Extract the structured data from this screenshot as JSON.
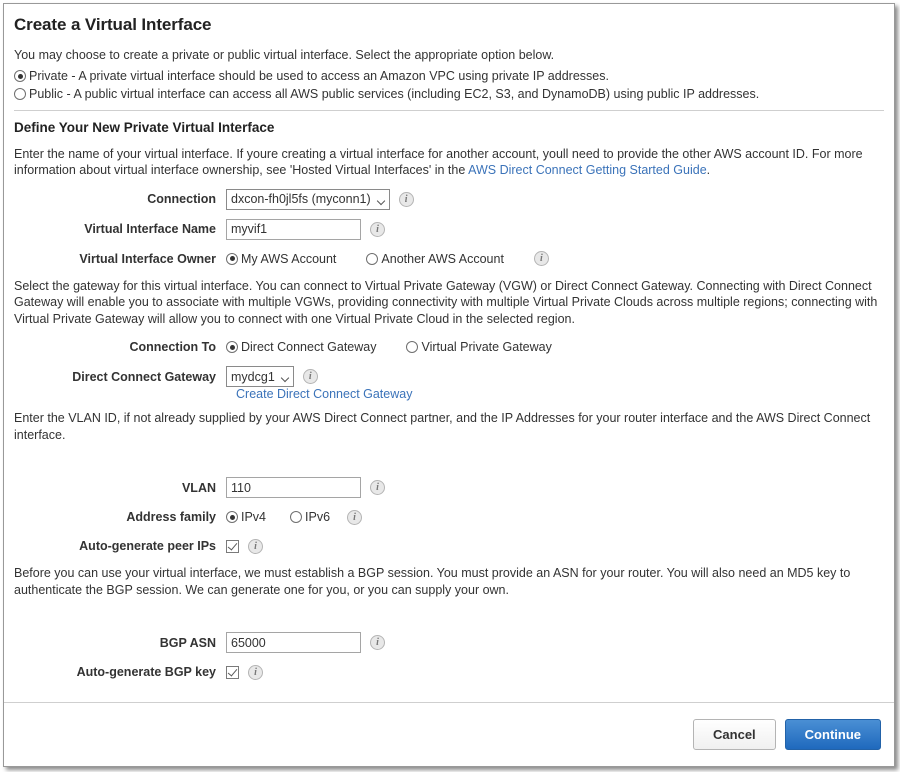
{
  "page": {
    "title": "Create a Virtual Interface",
    "intro": "You may choose to create a private or public virtual interface. Select the appropriate option below."
  },
  "interface_type": {
    "options": [
      {
        "label": "Private - A private virtual interface should be used to access an Amazon VPC using private IP addresses.",
        "selected": true
      },
      {
        "label": "Public - A public virtual interface can access all AWS public services (including EC2, S3, and DynamoDB) using public IP addresses.",
        "selected": false
      }
    ]
  },
  "define_section": {
    "heading": "Define Your New Private Virtual Interface",
    "description_part1": "Enter the name of your virtual interface. If youre creating a virtual interface for another account, youll need to provide the other AWS account ID. For more information about virtual interface ownership, see 'Hosted Virtual Interfaces' in the ",
    "link_text": "AWS Direct Connect Getting Started Guide",
    "description_part2": "."
  },
  "fields": {
    "connection": {
      "label": "Connection",
      "value": "dxcon-fh0jl5fs (myconn1)",
      "info": "i"
    },
    "virtual_interface_name": {
      "label": "Virtual Interface Name",
      "value": "myvif1",
      "placeholder": "",
      "info": "i"
    },
    "virtual_interface_owner": {
      "label": "Virtual Interface Owner",
      "options": [
        {
          "label": "My AWS Account",
          "selected": true
        },
        {
          "label": "Another AWS Account",
          "selected": false
        }
      ],
      "info": "i"
    },
    "connection_to": {
      "label": "Connection To",
      "options": [
        {
          "label": "Direct Connect Gateway",
          "selected": true
        },
        {
          "label": "Virtual Private Gateway",
          "selected": false
        }
      ]
    },
    "direct_connect_gateway": {
      "label": "Direct Connect Gateway",
      "value": "mydcg1",
      "info": "i",
      "create_link": "Create Direct Connect Gateway"
    },
    "vlan": {
      "label": "VLAN",
      "value": "110",
      "placeholder": "",
      "info": "i"
    },
    "address_family": {
      "label": "Address family",
      "options": [
        {
          "label": "IPv4",
          "selected": true
        },
        {
          "label": "IPv6",
          "selected": false
        }
      ],
      "info": "i"
    },
    "auto_generate_peer_ips": {
      "label": "Auto-generate peer IPs",
      "checked": true,
      "info": "i"
    },
    "bgp_asn": {
      "label": "BGP ASN",
      "value": "65000",
      "placeholder": "",
      "info": "i"
    },
    "auto_generate_bgp_key": {
      "label": "Auto-generate BGP key",
      "checked": true,
      "info": "i"
    }
  },
  "gateway_paragraph": "Select the gateway for this virtual interface. You can connect to Virtual Private Gateway (VGW) or Direct Connect Gateway. Connecting with Direct Connect Gateway will enable you to associate with multiple VGWs, providing connectivity with multiple Virtual Private Clouds across multiple regions; connecting with Virtual Private Gateway will allow you to connect with one Virtual Private Cloud in the selected region.",
  "vlan_paragraph": "Enter the VLAN ID, if not already supplied by your AWS Direct Connect partner, and the IP Addresses for your router interface and the AWS Direct Connect interface.",
  "bgp_paragraph": "Before you can use your virtual interface, we must establish a BGP session. You must provide an ASN for your router. You will also need an MD5 key to authenticate the BGP session. We can generate one for you, or you can supply your own.",
  "footer": {
    "cancel_label": "Cancel",
    "continue_label": "Continue"
  },
  "colors": {
    "link": "#3b73b9",
    "primary_button": "#1f69bd",
    "text": "#333333"
  }
}
